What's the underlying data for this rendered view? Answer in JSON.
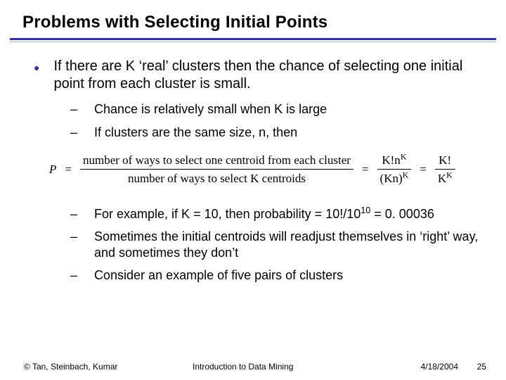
{
  "title": "Problems with Selecting Initial Points",
  "lvl1": "If there are K ‘real’ clusters then the chance of selecting one initial point from each cluster is small.",
  "sub": {
    "a": "Chance is relatively small when K is large",
    "b": "If clusters are the same size, n, then",
    "c_pre": "For example, if K = 10, then probability = 10!/10",
    "c_exp": "10",
    "c_post": " = 0. 00036",
    "d": "Sometimes the initial centroids will readjust themselves in ‘right’ way, and sometimes they don’t",
    "e": "Consider an example of five pairs of clusters"
  },
  "formula": {
    "P": "P",
    "num1": "number of ways to select one centroid from each cluster",
    "den1": "number of ways to select K centroids",
    "num2_a": "K!n",
    "num2_exp": "K",
    "den2_a": "(Kn)",
    "den2_exp": "K",
    "num3": "K!",
    "den3_a": "K",
    "den3_exp": "K"
  },
  "footer": {
    "left": "© Tan, Steinbach, Kumar",
    "center": "Introduction to Data Mining",
    "date": "4/18/2004",
    "page": "25"
  }
}
